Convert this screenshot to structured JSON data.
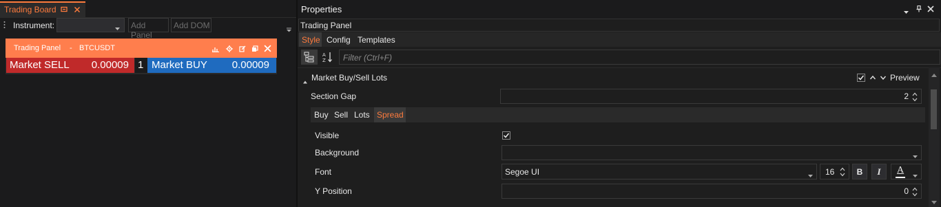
{
  "colors": {
    "accent": "#ff7b3d",
    "sell": "#c02a2a",
    "buy": "#1f6bbf",
    "panel_bg": "#1b1b1c"
  },
  "left": {
    "tab_title": "Trading Board",
    "instrument_label": "Instrument:",
    "add_panel": "Add Panel",
    "add_dom": "Add DOM",
    "trading_panel": {
      "title": "Trading Panel",
      "sep": "-",
      "symbol": "BTCUSDT",
      "sell_label": "Market SELL",
      "sell_price": "0.00009",
      "qty": "1",
      "buy_label": "Market BUY",
      "buy_price": "0.00009"
    }
  },
  "right": {
    "header_title": "Properties",
    "object_name": "Trading Panel",
    "tabs": [
      "Style",
      "Config",
      "Templates"
    ],
    "filter_placeholder": "Filter (Ctrl+F)",
    "section": {
      "title": "Market Buy/Sell Lots",
      "preview_label": "Preview",
      "preview_checked": true
    },
    "section_gap": {
      "label": "Section Gap",
      "value": "2"
    },
    "subtabs": [
      "Buy",
      "Sell",
      "Lots",
      "Spread"
    ],
    "active_subtab": "Spread",
    "props": {
      "visible": {
        "label": "Visible",
        "checked": true
      },
      "background": {
        "label": "Background",
        "value": ""
      },
      "font": {
        "label": "Font",
        "family": "Segoe UI",
        "size": "16",
        "bold": "B",
        "italic": "I",
        "color_glyph": "A"
      },
      "y_position": {
        "label": "Y Position",
        "value": "0"
      }
    }
  }
}
